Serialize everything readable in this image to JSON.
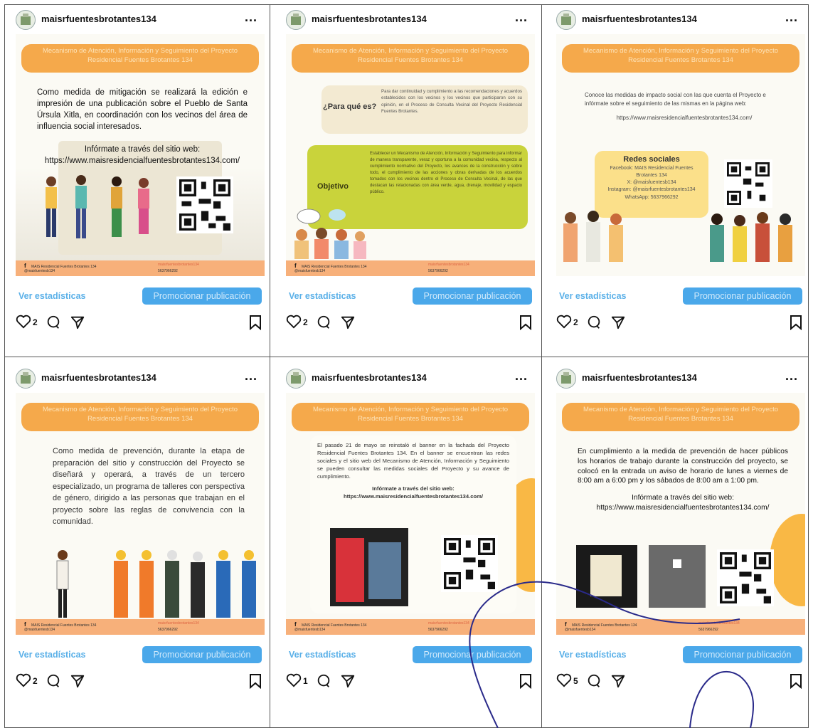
{
  "account": "maisrfuentesbrotantes134",
  "more_label": "...",
  "banner_title": "Mecanismo de Atención, Información y Seguimiento del Proyecto Residencial Fuentes Brotantes 134",
  "actions": {
    "stats_label": "Ver estadísticas",
    "promote_label": "Promocionar publicación"
  },
  "footer": {
    "facebook": "MAIS Residencial Fuentes Brotantes 134",
    "handle": "@maisfuentesb134",
    "email": "maisrfuentesbrotantes134",
    "phone": "5637966292"
  },
  "posts": [
    {
      "likes": "2",
      "text": "Como medida de mitigación se realizará la edición e impresión de una publicación sobre el Pueblo de Santa Úrsula Xitla, en coordinación con los vecinos del área de influencia social interesados.",
      "info": "Infórmate a través del sitio web:",
      "url": "https://www.maisresidencialfuentesbrotantes134.com/"
    },
    {
      "likes": "2",
      "q_label": "¿Para qué es?",
      "q_text": "Para dar continuidad y cumplimiento a las recomendaciones y acuerdos establecidos con los vecinos y los vecinos que participaron con su opinión, en el Proceso de Consulta Vecinal del Proyecto Residencial Fuentes Brotantes.",
      "obj_label": "Objetivo",
      "obj_text": "Establecer un Mecanismo de Atención, Información y Seguimiento para informar de manera transparente, veraz y oportuna a la comunidad vecina, respecto al cumplimiento normativo del Proyecto, los avances de la construcción y sobre todo, el cumplimiento de las acciones y obras derivadas de los acuerdos tomados con los vecinos dentro el Proceso de Consulta Vecinal, de las que destacan las relacionadas con área verde, agua, drenaje, movilidad y espacio público."
    },
    {
      "likes": "2",
      "text": "Conoce las medidas de impacto social con las que cuenta el Proyecto e infórmate sobre el seguimiento de las mismas en la página web:",
      "url": "https://www.maisresidencialfuentesbrotantes134.com/",
      "social_title": "Redes sociales",
      "social_lines": [
        "Facebook: MAIS Residencial Fuentes",
        "Brotantes 134",
        "X: @maisfuentesb134",
        "Instagram: @maisrfuentesbrotantes134",
        "WhatsApp: 5637966292"
      ]
    },
    {
      "likes": "2",
      "text": "Como medida de prevención, durante la etapa de preparación del sitio y construcción del Proyecto se diseñará y operará, a través de un tercero especializado, un programa de talleres con perspectiva de género, dirigido a las personas que trabajan en el proyecto sobre las reglas de convivencia con la comunidad."
    },
    {
      "likes": "1",
      "text": "El pasado 21 de mayo se reinstaló el banner en la fachada del Proyecto Residencial Fuentes Brotantes 134. En el banner se encuentran las redes sociales y el sitio web del Mecanismo de Atención, Información y Seguimiento se pueden consultar las medidas sociales del Proyecto y su avance de cumplimiento.",
      "info": "Infórmate a través del sitio web:",
      "url": "https://www.maisresidencialfuentesbrotantes134.com/"
    },
    {
      "likes": "5",
      "text": "En cumplimiento a la medida de prevención de hacer públicos los horarios de trabajo durante la construcción del proyecto, se colocó en la entrada un aviso de horario de lunes a viernes de 8:00 am a 6:00 pm y los sábados de 8:00 am a 1:00 pm.",
      "info": "Infórmate a través del sitio web:",
      "url": "https://www.maisresidencialfuentesbrotantes134.com/"
    }
  ],
  "colors": {
    "banner": "#f5a94b",
    "button": "#4aa8ea",
    "link": "#5ab0e8",
    "objective_card": "#c9d33b",
    "social_card": "#fbe08a"
  },
  "icons": [
    "heart-icon",
    "comment-icon",
    "share-icon",
    "bookmark-icon",
    "qr-code",
    "facebook-icon"
  ]
}
